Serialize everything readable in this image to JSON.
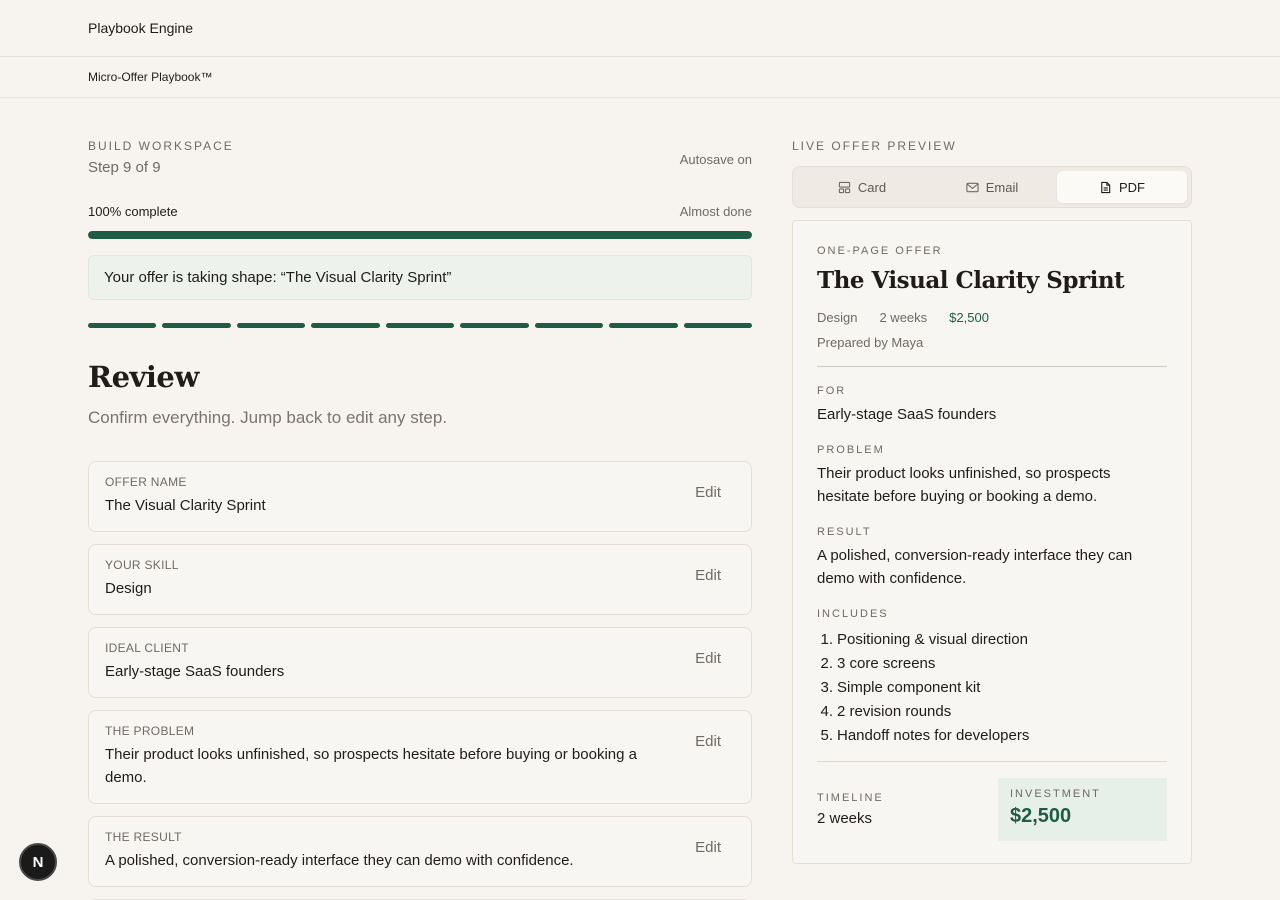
{
  "app": {
    "title": "Playbook Engine",
    "subtitle": "Micro-Offer Playbook™"
  },
  "workspace": {
    "eyebrow": "BUILD WORKSPACE",
    "step": "Step 9 of 9",
    "autosave": "Autosave on",
    "progress_label": "100% complete",
    "progress_value": 100,
    "progress_status": "Almost done",
    "shape_note": "Your offer is taking shape: “The Visual Clarity Sprint”",
    "steps_total": 9,
    "steps_done": 9
  },
  "review": {
    "title": "Review",
    "subtitle": "Confirm everything. Jump back to edit any step.",
    "edit_label": "Edit",
    "items": [
      {
        "label": "OFFER NAME",
        "value": "The Visual Clarity Sprint"
      },
      {
        "label": "YOUR SKILL",
        "value": "Design"
      },
      {
        "label": "IDEAL CLIENT",
        "value": "Early-stage SaaS founders"
      },
      {
        "label": "THE PROBLEM",
        "value": "Their product looks unfinished, so prospects hesitate before buying or booking a demo."
      },
      {
        "label": "THE RESULT",
        "value": "A polished, conversion-ready interface they can demo with confidence."
      }
    ]
  },
  "preview": {
    "eyebrow": "LIVE OFFER PREVIEW",
    "tabs": [
      {
        "label": "Card",
        "icon": "card-icon",
        "active": false
      },
      {
        "label": "Email",
        "icon": "mail-icon",
        "active": false
      },
      {
        "label": "PDF",
        "icon": "document-icon",
        "active": true
      }
    ],
    "card": {
      "eyebrow": "ONE-PAGE OFFER",
      "title": "The Visual Clarity Sprint",
      "skill": "Design",
      "duration": "2 weeks",
      "price": "$2,500",
      "prepared_by": "Prepared by Maya",
      "for_label": "FOR",
      "for_value": "Early-stage SaaS founders",
      "problem_label": "PROBLEM",
      "problem_value": "Their product looks unfinished, so prospects hesitate before buying or booking a demo.",
      "result_label": "RESULT",
      "result_value": "A polished, conversion-ready interface they can demo with confidence.",
      "includes_label": "INCLUDES",
      "includes": [
        "Positioning & visual direction",
        "3 core screens",
        "Simple component kit",
        "2 revision rounds",
        "Handoff notes for developers"
      ],
      "timeline_label": "TIMELINE",
      "timeline_value": "2 weeks",
      "investment_label": "INVESTMENT",
      "investment_value": "$2,500"
    }
  },
  "fab": {
    "label": "N"
  },
  "colors": {
    "accent": "#1e5c47",
    "background": "#f7f4ef"
  }
}
